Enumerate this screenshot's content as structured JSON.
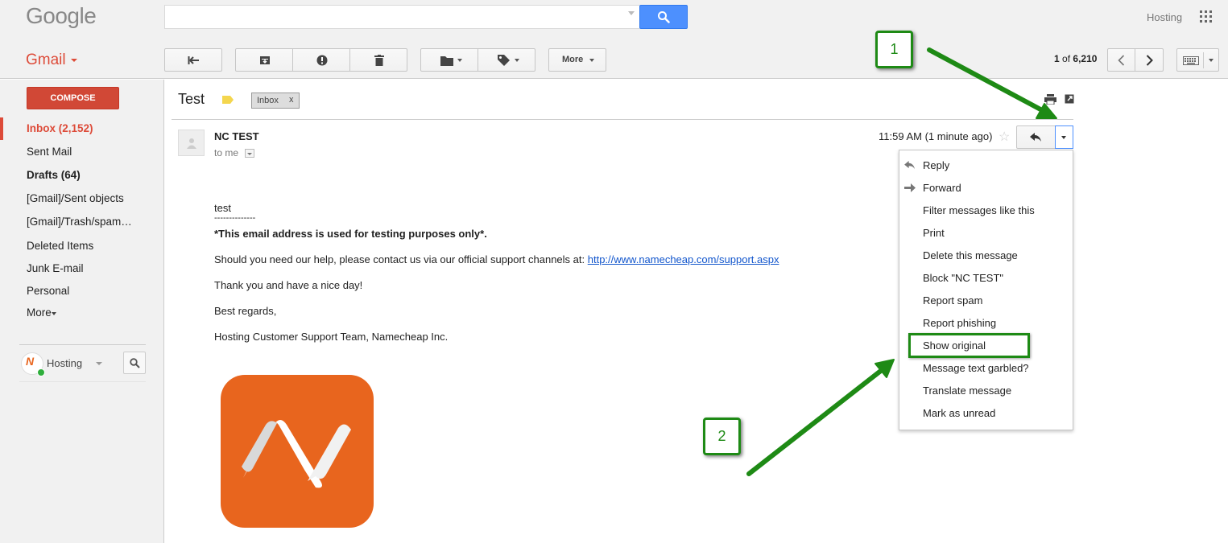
{
  "header": {
    "logo": "Google",
    "search_value": "",
    "account_name": "Hosting"
  },
  "app": {
    "name": "Gmail"
  },
  "toolbar": {
    "more_label": "More",
    "pager_range": "1",
    "pager_of": "of",
    "pager_total": "6,210"
  },
  "sidebar": {
    "compose_label": "COMPOSE",
    "items": [
      {
        "label": "Inbox (2,152)"
      },
      {
        "label": "Sent Mail"
      },
      {
        "label": "Drafts (64)"
      },
      {
        "label": "[Gmail]/Sent objects"
      },
      {
        "label": "[Gmail]/Trash/spam…"
      },
      {
        "label": "Deleted Items"
      },
      {
        "label": "Junk E-mail"
      },
      {
        "label": "Personal"
      },
      {
        "label": "More"
      }
    ],
    "hangouts_label": "Hosting"
  },
  "message": {
    "subject": "Test",
    "label_chip": "Inbox",
    "label_chip_close": "x",
    "sender": "NC TEST",
    "recipient": "to me",
    "timestamp": "11:59 AM (1 minute ago)",
    "body": {
      "greeting": "test",
      "separator": "--------------",
      "notice": "*This email address is used for testing purposes only*.",
      "support_text": "Should you need our help, please contact us via our official support channels at: ",
      "support_link": "http://www.namecheap.com/support.aspx",
      "thanks": "Thank you and have a nice day!",
      "regards": "Best regards,",
      "signature": "Hosting Customer Support Team, Namecheap Inc."
    }
  },
  "menu": {
    "items": [
      {
        "label": "Reply"
      },
      {
        "label": "Forward"
      },
      {
        "label": "Filter messages like this"
      },
      {
        "label": "Print"
      },
      {
        "label": "Delete this message"
      },
      {
        "label": "Block \"NC TEST\""
      },
      {
        "label": "Report spam"
      },
      {
        "label": "Report phishing"
      },
      {
        "label": "Show original"
      },
      {
        "label": "Message text garbled?"
      },
      {
        "label": "Translate message"
      },
      {
        "label": "Mark as unread"
      }
    ]
  },
  "annotations": {
    "step_1": "1",
    "step_2": "2",
    "color": "#1e8a15"
  },
  "colors": {
    "accent_red": "#dd4b39",
    "search_blue": "#4d90fe",
    "link_blue": "#1155cc",
    "namecheap_orange": "#e8651e"
  },
  "icons": [
    "search-icon",
    "apps-grid-icon",
    "back-arrow-icon",
    "archive-icon",
    "spam-icon",
    "trash-icon",
    "folder-icon",
    "label-icon",
    "chevron-left-icon",
    "chevron-right-icon",
    "keyboard-icon",
    "print-icon",
    "popout-icon",
    "reply-icon",
    "forward-icon",
    "star-icon",
    "person-icon"
  ]
}
